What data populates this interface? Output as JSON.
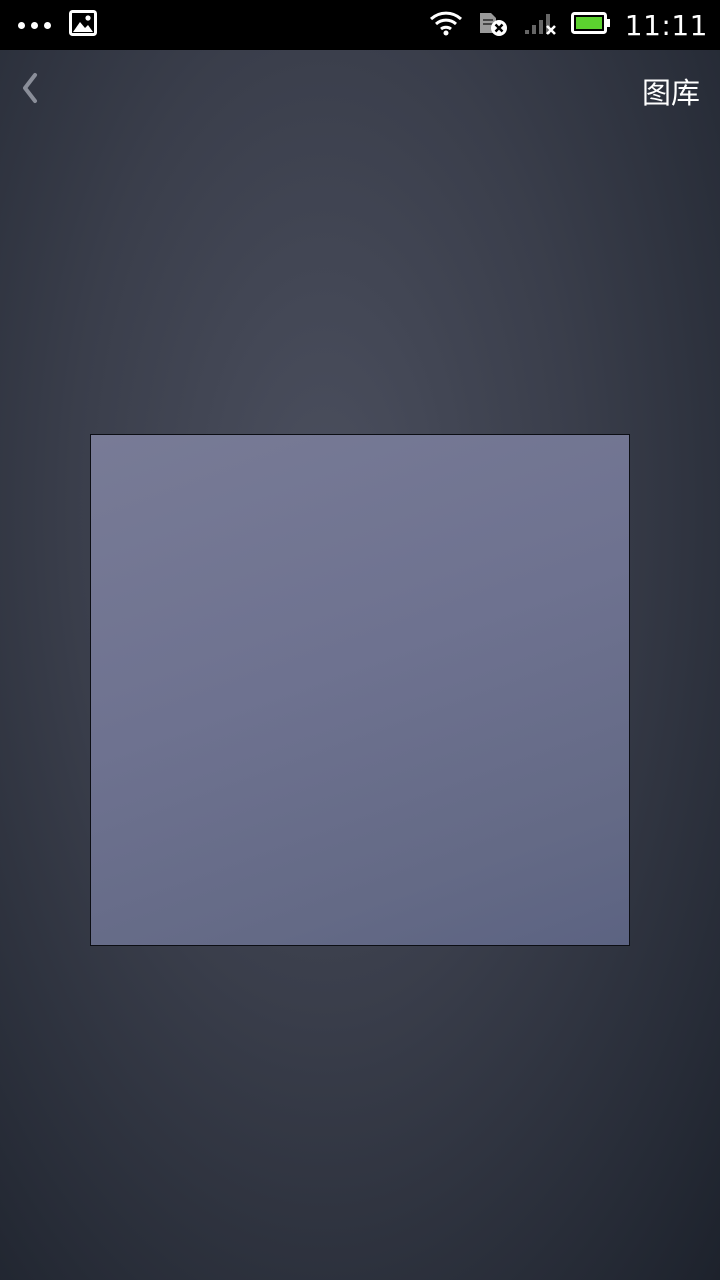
{
  "status_bar": {
    "time": "11:11",
    "icons": [
      "more-dots-icon",
      "image-notification-icon",
      "wifi-icon",
      "sim-error-icon",
      "signal-off-icon",
      "battery-icon"
    ],
    "battery_color": "#5cd12f"
  },
  "toolbar": {
    "back_icon": "chevron-left-icon",
    "gallery_label": "图库"
  },
  "scanner": {
    "frame_color": "#6e7290"
  }
}
